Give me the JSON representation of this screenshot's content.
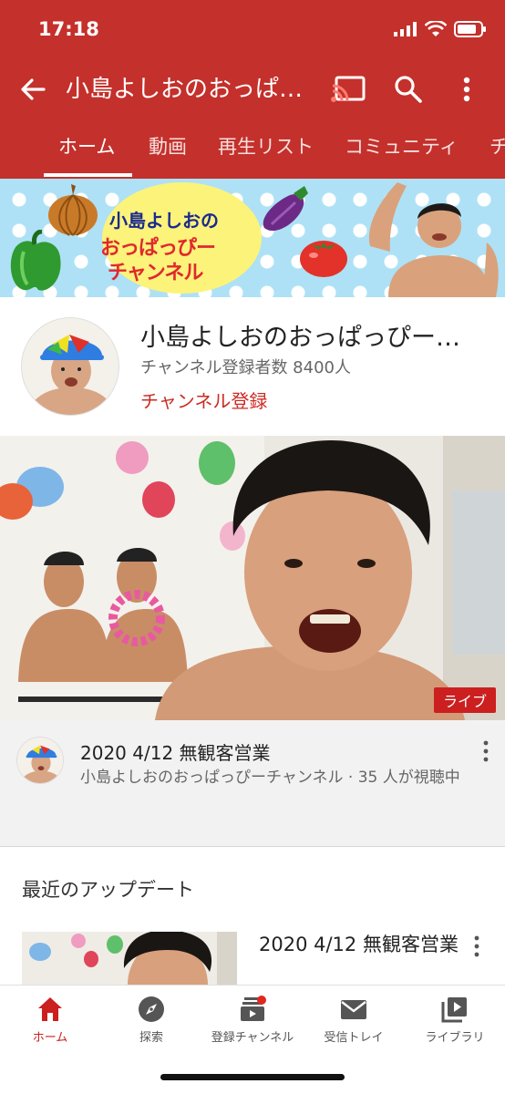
{
  "status_bar": {
    "time": "17:18"
  },
  "app_bar": {
    "title": "小島よしおのおっぱ…",
    "back_icon": "arrow-back-icon",
    "cast_icon": "cast-icon",
    "search_icon": "search-icon",
    "more_icon": "more-vert-icon",
    "color": "#c4302b"
  },
  "tabs": [
    {
      "label": "ホーム",
      "active": true
    },
    {
      "label": "動画",
      "active": false
    },
    {
      "label": "再生リスト",
      "active": false
    },
    {
      "label": "コミュニティ",
      "active": false
    },
    {
      "label": "チ",
      "active": false
    }
  ],
  "banner": {
    "line1": "小島よしおの",
    "line2": "おっぱっぴー",
    "line3": "チャンネル"
  },
  "channel": {
    "name": "小島よしおのおっぱっぴー…",
    "subscribers": "チャンネル登録者数 8400人",
    "subscribe_label": "チャンネル登録"
  },
  "live_video": {
    "badge": "ライブ",
    "title": "2020 4/12 無観客営業",
    "subtitle": "小島よしおのおっぱっぴーチャンネル · 35 人が視聴中"
  },
  "recent": {
    "section_title": "最近のアップデート",
    "item_title": "2020 4/12 無観客営業"
  },
  "bottom_nav": [
    {
      "label": "ホーム",
      "icon": "home-icon",
      "active": true
    },
    {
      "label": "探索",
      "icon": "explore-icon",
      "active": false
    },
    {
      "label": "登録チャンネル",
      "icon": "subscriptions-icon",
      "active": false
    },
    {
      "label": "受信トレイ",
      "icon": "inbox-icon",
      "active": false
    },
    {
      "label": "ライブラリ",
      "icon": "library-icon",
      "active": false
    }
  ]
}
